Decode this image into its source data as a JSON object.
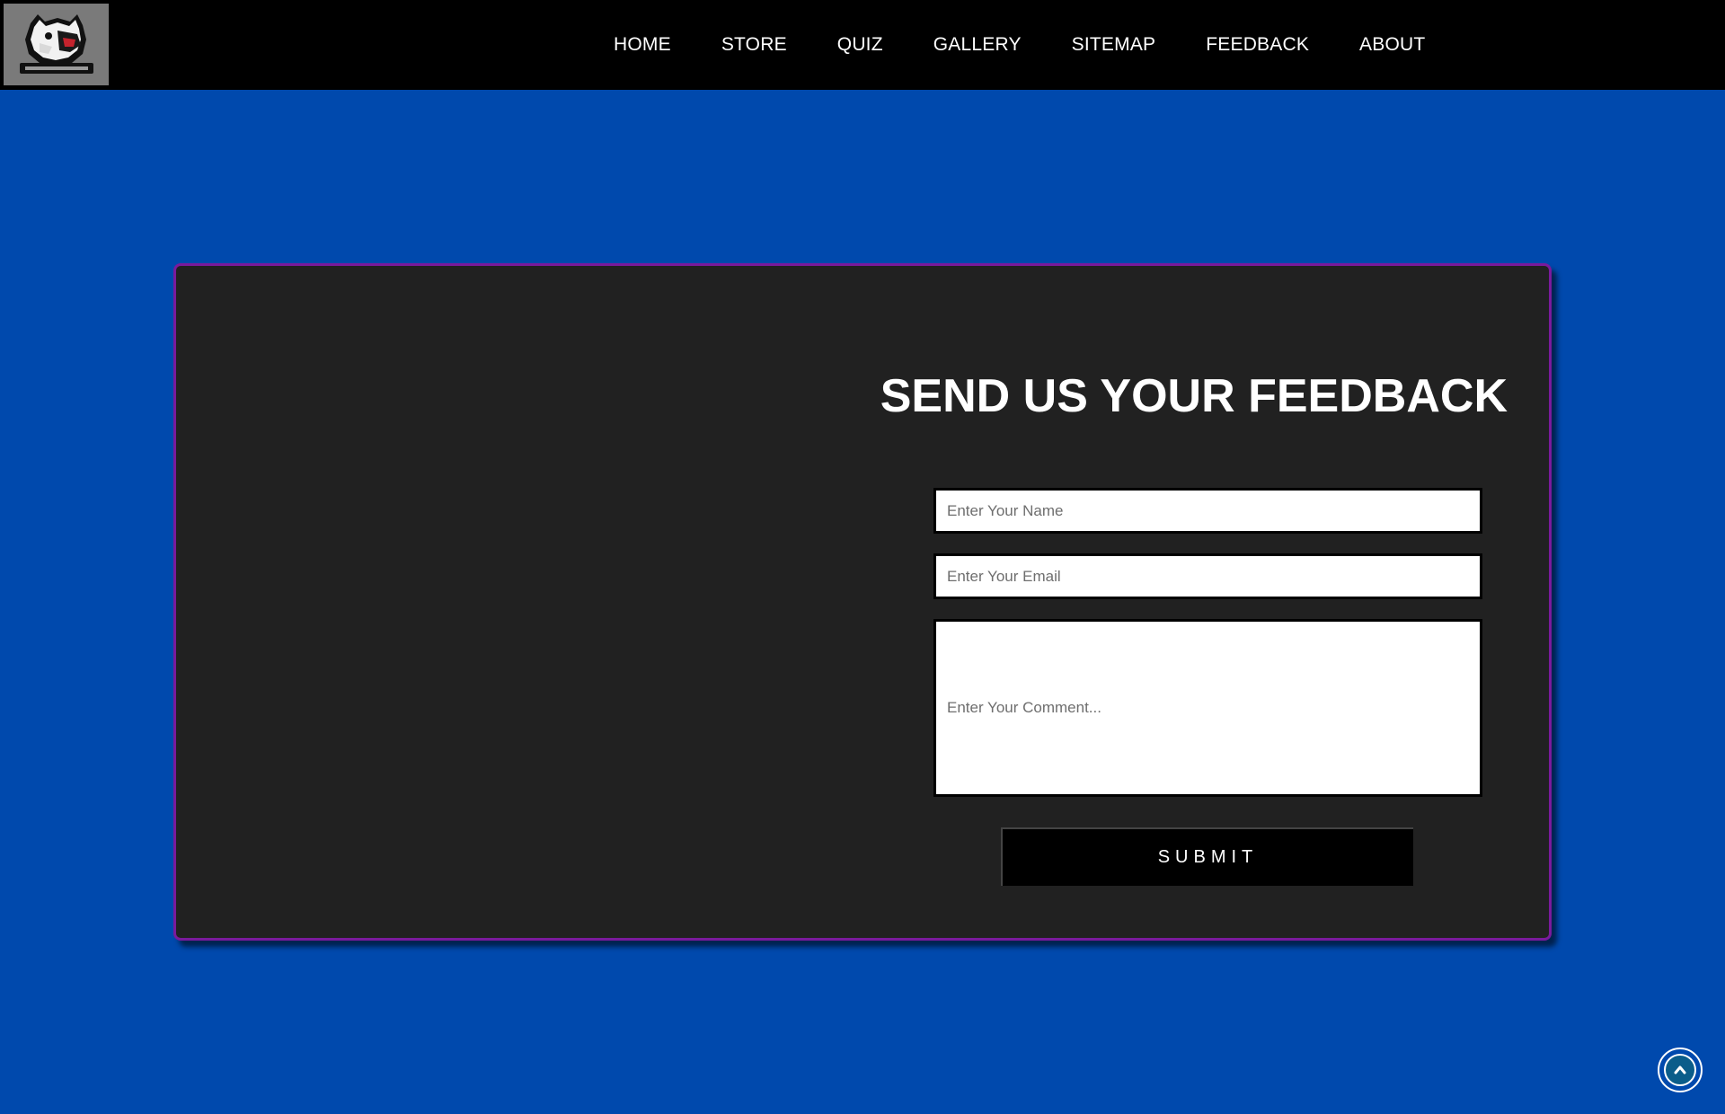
{
  "header": {
    "logo_icon": "gaming-bear-logo-icon",
    "nav": [
      {
        "label": "HOME"
      },
      {
        "label": "STORE"
      },
      {
        "label": "QUIZ"
      },
      {
        "label": "GALLERY"
      },
      {
        "label": "SITEMAP"
      },
      {
        "label": "FEEDBACK"
      },
      {
        "label": "ABOUT"
      }
    ]
  },
  "feedback": {
    "title": "SEND US YOUR FEEDBACK",
    "name_placeholder": "Enter Your Name",
    "email_placeholder": "Enter Your Email",
    "comment_placeholder": "Enter Your Comment...",
    "submit_label": "SUBMIT"
  },
  "scroll_top": {
    "icon": "chevron-up-icon"
  },
  "colors": {
    "page_background": "#0049ad",
    "navbar_background": "#000000",
    "card_background": "#212121",
    "card_border": "#7a1a9c",
    "accent_button": "#000000",
    "scroll_top_fill": "#0b5d8a"
  }
}
